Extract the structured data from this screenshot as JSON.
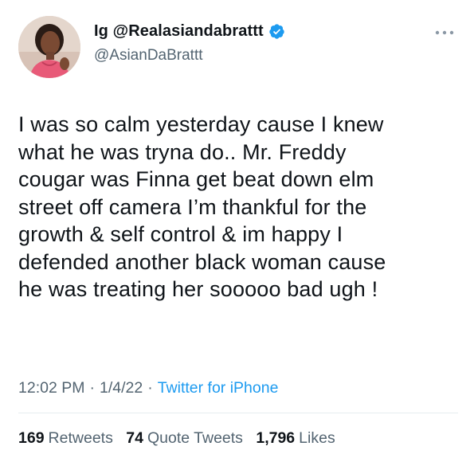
{
  "author": {
    "display_name": "Ig @Realasiandabrattt",
    "handle": "@AsianDaBrattt",
    "verified": true,
    "avatar_icon": "profile-photo"
  },
  "tweet": {
    "text": "I was so calm yesterday cause I knew\nwhat he was tryna do.. Mr. Freddy\ncougar was Finna get beat down elm\nstreet off camera I’m thankful for the\ngrowth & self control & im happy I\ndefended another black woman cause\nhe was treating her sooooo bad ugh !",
    "time": "12:02 PM",
    "date": "1/4/22",
    "separator": "·",
    "source": "Twitter for iPhone"
  },
  "stats": {
    "retweets_count": "169",
    "retweets_label": "Retweets",
    "quote_tweets_count": "74",
    "quote_tweets_label": "Quote Tweets",
    "likes_count": "1,796",
    "likes_label": "Likes"
  },
  "colors": {
    "text": "#0f1419",
    "secondary": "#536471",
    "accent": "#1d9bf0",
    "verified": "#1d9bf0",
    "divider": "#e6ecf0"
  }
}
